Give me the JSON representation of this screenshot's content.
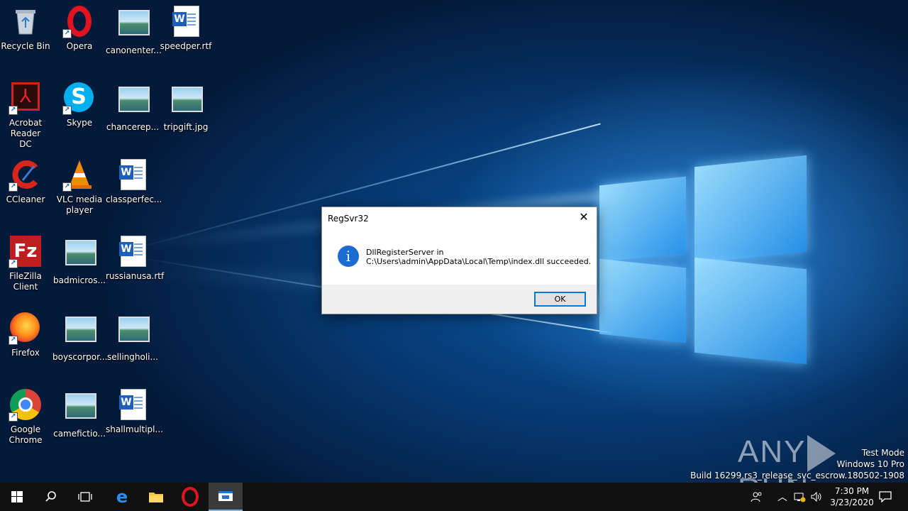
{
  "desktop": {
    "icons": [
      {
        "label": "Recycle Bin"
      },
      {
        "label": "Opera"
      },
      {
        "label": "canonenter..."
      },
      {
        "label": "speedper.rtf"
      },
      {
        "label": "Acrobat Reader DC"
      },
      {
        "label": "Skype"
      },
      {
        "label": "chancerep..."
      },
      {
        "label": "tripgift.jpg"
      },
      {
        "label": "CCleaner"
      },
      {
        "label": "VLC media player"
      },
      {
        "label": "classperfec..."
      },
      {
        "label": "FileZilla Client"
      },
      {
        "label": "badmicros..."
      },
      {
        "label": "russianusa.rtf"
      },
      {
        "label": "Firefox"
      },
      {
        "label": "boyscorpor..."
      },
      {
        "label": "sellingholi..."
      },
      {
        "label": "Google Chrome"
      },
      {
        "label": "camefictio..."
      },
      {
        "label": "shallmultipl..."
      }
    ]
  },
  "dialog": {
    "title": "RegSvr32",
    "close_glyph": "✕",
    "message_line1": "DllRegisterServer in",
    "message_line2": "C:\\Users\\admin\\AppData\\Local\\Temp\\index.dll succeeded.",
    "ok_label": "OK"
  },
  "watermark": {
    "left": "ANY",
    "right": "RUN"
  },
  "system_info": {
    "line1": "Test Mode",
    "line2": "Windows 10 Pro",
    "line3": "Build 16299.rs3_release_svc_escrow.180502-1908"
  },
  "taskbar": {
    "time": "7:30 PM",
    "date": "3/23/2020"
  },
  "colors": {
    "accent": "#0078d7",
    "dialog_footer": "#f0f0f0",
    "taskbar": "#101010"
  }
}
